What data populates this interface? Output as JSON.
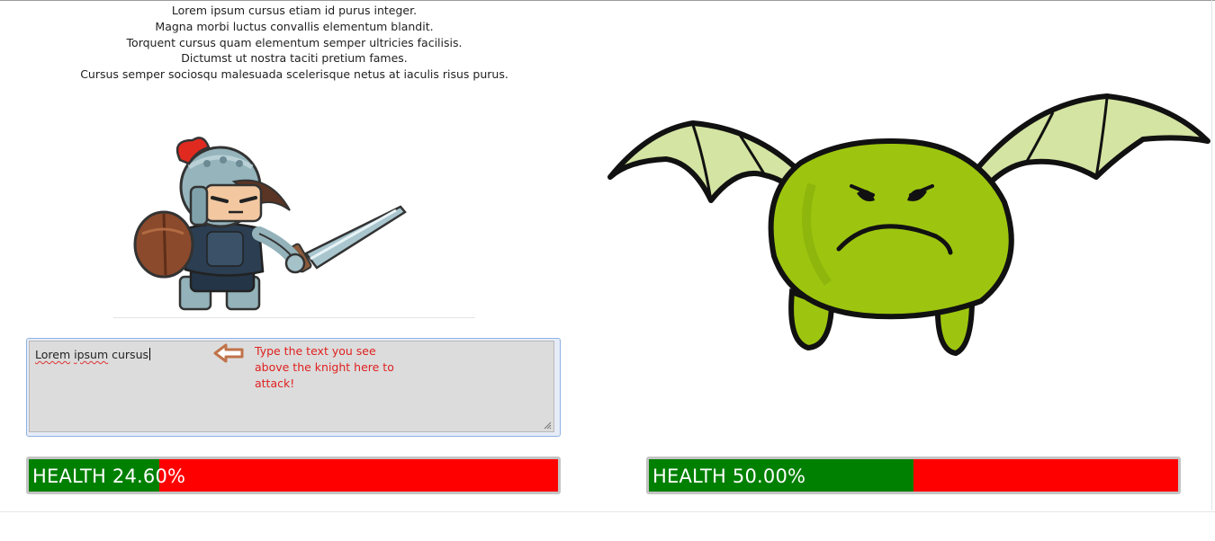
{
  "passage": {
    "lines": [
      "Lorem ipsum cursus etiam id purus integer.",
      "Magna morbi luctus convallis elementum blandit.",
      "Torquent cursus quam elementum semper ultricies facilisis.",
      "Dictumst ut nostra taciti pretium fames.",
      "Cursus semper sociosqu malesuada scelerisque netus at iaculis risus purus."
    ]
  },
  "typing": {
    "value_part1": "Lorem",
    "value_part2": "ipsum",
    "value_part3": "cursus"
  },
  "hint": {
    "text": "Type the text you see above the knight here to attack!",
    "icon": "left-arrow-icon",
    "color": "#e02020"
  },
  "player_health": {
    "label": "HEALTH 24.60%",
    "percent": 24.6
  },
  "enemy_health": {
    "label": "HEALTH 50.00%",
    "percent": 50.0
  },
  "colors": {
    "health_fill": "#008000",
    "health_empty": "#ff0000",
    "monster_body": "#9dc50f",
    "monster_wing": "#d4e4a2"
  },
  "characters": {
    "player": "knight-sprite",
    "enemy": "green-bat-monster-sprite"
  }
}
